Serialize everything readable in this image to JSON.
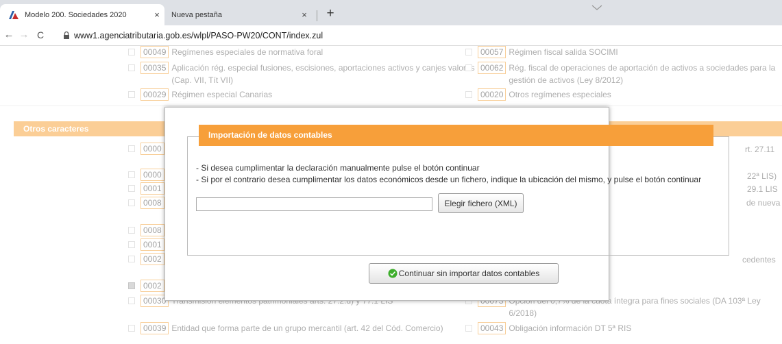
{
  "browser": {
    "tabs": [
      {
        "title": "Modelo 200. Sociedades 2020",
        "close": "×"
      },
      {
        "title": "Nueva pestaña",
        "close": "×"
      }
    ],
    "new_tab": "+",
    "url": "www1.agenciatributaria.gob.es/wlpl/PASO-PW20/CONT/index.zul",
    "back": "←",
    "forward": "→",
    "reload": "C"
  },
  "regimes": [
    {
      "code": "00049",
      "text": "Regímenes especiales de normativa foral"
    },
    {
      "code": "00057",
      "text": "Régimen fiscal salida SOCIMI"
    },
    {
      "code": "00035",
      "text": "Aplicación rég. especial fusiones, escisiones, aportaciones activos y canjes valores (Cap. VII, Tít VII)"
    },
    {
      "code": "00062",
      "text": "Rég. fiscal de operaciones de aportación de activos a sociedades para la gestión de activos (Ley 8/2012)"
    },
    {
      "code": "00029",
      "text": "Régimen especial Canarias"
    },
    {
      "code": "00020",
      "text": "Otros regímenes especiales"
    }
  ],
  "section": {
    "title": "Otros caracteres"
  },
  "left_codes": [
    "0000",
    "0000",
    "0001",
    "0008",
    "0008",
    "0001",
    "0002",
    "0002",
    "0003"
  ],
  "right_fragments": [
    "rt. 27.11",
    "22ª LIS)",
    "29.1 LIS",
    "de nueva",
    "cedentes"
  ],
  "bottom_items": [
    {
      "code": "00030",
      "text": "Transmisión elementos patrimoniales arts. 27.2.d) y 77.1 LIS"
    },
    {
      "code": "00073",
      "text": "Opción del 0,7% de la cuota íntegra para fines sociales (DA 103ª Ley 6/2018)"
    },
    {
      "code": "00039",
      "text": "Entidad que forma parte de un grupo mercantil (art. 42 del Cód. Comercio)"
    },
    {
      "code": "00043",
      "text": "Obligación información DT 5ª RIS"
    }
  ],
  "modal": {
    "title": "Importación de datos contables",
    "instruction1": "- Si desea cumplimentar la declaración manualmente pulse el botón continuar",
    "instruction2": "- Si por el contrario desea cumplimentar los datos económicos desde un fichero, indique la ubicación del mismo, y pulse el botón continuar",
    "file_value": "",
    "file_button": "Elegir fichero (XML)",
    "continue_button": "Continuar sin importar datos contables"
  },
  "colors": {
    "accent": "#f7a640",
    "code_border": "#f3a744",
    "ok_icon": "#3eae2c"
  }
}
